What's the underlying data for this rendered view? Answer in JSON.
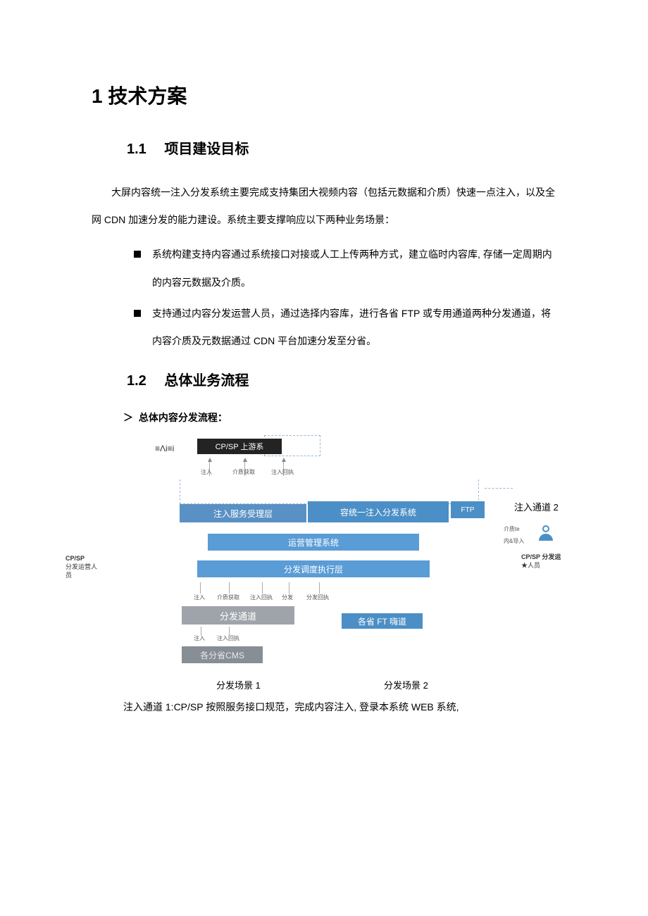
{
  "headings": {
    "h1": "1 技术方案",
    "h2_1_num": "1.1",
    "h2_1_text": "项目建设目标",
    "h2_2_num": "1.2",
    "h2_2_text": "总体业务流程"
  },
  "section1": {
    "para": "大屏内容统一注入分发系统主要完成支持集团大视频内容（包括元数据和介质）快速一点注入，以及全网 CDN 加速分发的能力建设。系统主要支撑响应以下两种业务场景：",
    "bullets": [
      "系统构建支持内容通过系统接口对接或人工上传两种方式，建立临时内容库, 存储一定周期内的内容元数据及介质。",
      "支持通过内容分发运营人员，通过选择内容库，进行各省 FTP 或专用通道两种分发通道，将内容介质及元数据通过 CDN 平台加速分发至分省。"
    ]
  },
  "section2": {
    "subheading": "总体内容分发流程：",
    "diagram": {
      "top_equation": "≡Λi≡i",
      "cpsp_upstream": "CP/SP 上游系",
      "arrows_row1": [
        "注入",
        "介质获取",
        "注入回执"
      ],
      "layer_accept": "注入服务受理层",
      "system_title": "容统一注入分发系统",
      "ftp_box": "FTP",
      "channel2_label": "注入通道 2",
      "right_small_labels": [
        "介质te",
        "内&导入"
      ],
      "right_role_lines": [
        "CP/SP 分发运",
        "★人员"
      ],
      "layer_ops": "运营管理系统",
      "layer_exec": "分发调度执行层",
      "left_role_lines": [
        "CP/SP",
        "分发运营人",
        "员"
      ],
      "arrows_row2": [
        "注入",
        "介质获取",
        "注入回执",
        "分发",
        "分发回执"
      ],
      "dist_channel": "分发通道",
      "ft_channel": "各省 FT 嗨道",
      "arrows_row3": [
        "注入",
        "注入回执"
      ],
      "cms_box": "各分省CMS",
      "scene1": "分发场景 1",
      "scene2": "分发场景 2"
    },
    "footer_para": "注入通道 1:CP/SP 按照服务接口规范，完成内容注入, 登录本系统 WEB 系统,"
  }
}
